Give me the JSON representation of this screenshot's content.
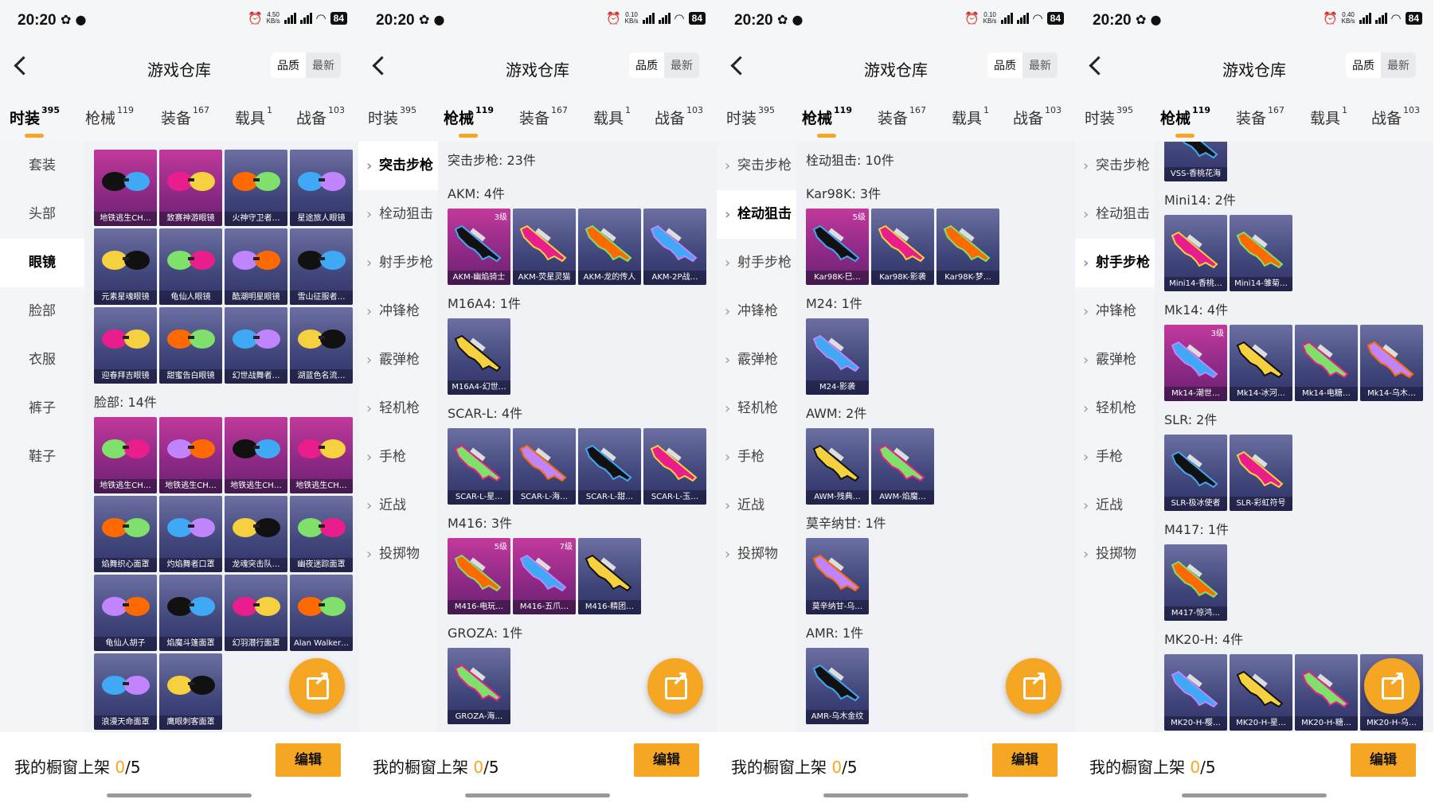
{
  "status": {
    "time": "20:20",
    "battery": "84",
    "apps": "✿ ●",
    "speeds": [
      "4.50",
      "0.10",
      "0.10",
      "0.40"
    ],
    "speed_unit": "KB/s"
  },
  "header": {
    "title": "游戏仓库",
    "sort_quality": "品质",
    "sort_latest": "最新"
  },
  "tabs": [
    {
      "label": "时装",
      "count": "395"
    },
    {
      "label": "枪械",
      "count": "119"
    },
    {
      "label": "装备",
      "count": "167"
    },
    {
      "label": "载具",
      "count": "1"
    },
    {
      "label": "战备",
      "count": "103"
    }
  ],
  "fashion_sidebar": [
    "套装",
    "头部",
    "眼镜",
    "脸部",
    "衣服",
    "裤子",
    "鞋子"
  ],
  "gun_sidebar": [
    "突击步枪",
    "栓动狙击",
    "射手步枪",
    "冲锋枪",
    "霰弹枪",
    "轻机枪",
    "手枪",
    "近战",
    "投掷物"
  ],
  "bottom": {
    "label": "我的橱窗上架 ",
    "count": "0",
    "total": "/5",
    "edit": "编辑"
  },
  "panel1": {
    "glasses": [
      {
        "name": "地铁逃生CH…",
        "purple": true
      },
      {
        "name": "致赛神游眼镜",
        "purple": true
      },
      {
        "name": "火神守卫者…",
        "purple": false
      },
      {
        "name": "星途旅人眼镜",
        "purple": false
      },
      {
        "name": "元素星魂眼镜",
        "purple": false
      },
      {
        "name": "龟仙人眼镜",
        "purple": false
      },
      {
        "name": "酷潮明星眼镜",
        "purple": false
      },
      {
        "name": "雪山征服者…",
        "purple": false
      },
      {
        "name": "迎春拜吉眼镜",
        "purple": false
      },
      {
        "name": "甜蜜告白眼镜",
        "purple": false
      },
      {
        "name": "幻世战舞者…",
        "purple": false
      },
      {
        "name": "湖蓝色名流…",
        "purple": false
      }
    ],
    "face_title": "脸部: 14件",
    "face": [
      {
        "name": "地铁逃生CH…",
        "purple": true
      },
      {
        "name": "地铁逃生CH…",
        "purple": true
      },
      {
        "name": "地铁逃生CH…",
        "purple": true
      },
      {
        "name": "地铁逃生CH…",
        "purple": true
      },
      {
        "name": "焰舞织心面罩",
        "purple": false
      },
      {
        "name": "灼焰舞者口罩",
        "purple": false
      },
      {
        "name": "龙魂突击队…",
        "purple": false
      },
      {
        "name": "幽夜迷踪面罩",
        "purple": false
      },
      {
        "name": "龟仙人胡子",
        "purple": false
      },
      {
        "name": "焰魔斗篷面罩",
        "purple": false
      },
      {
        "name": "幻羽潜行面罩",
        "purple": false
      },
      {
        "name": "Alan Walker…",
        "purple": false
      },
      {
        "name": "浪漫天命面罩",
        "purple": false
      },
      {
        "name": "鹰眼刺客面罩",
        "purple": false
      }
    ]
  },
  "panel2": {
    "sections": [
      {
        "title": "突击步枪: 23件",
        "items": []
      },
      {
        "title": "AKM: 4件",
        "items": [
          {
            "name": "AKM-幽焰骑士",
            "purple": true,
            "level": "3级"
          },
          {
            "name": "AKM-荧星灵猫",
            "purple": false,
            "level": ""
          },
          {
            "name": "AKM-龙的传人",
            "purple": false,
            "level": ""
          },
          {
            "name": "AKM-2P战…",
            "purple": false,
            "level": ""
          }
        ]
      },
      {
        "title": "M16A4: 1件",
        "items": [
          {
            "name": "M16A4-幻世…",
            "purple": false,
            "level": ""
          }
        ]
      },
      {
        "title": "SCAR-L: 4件",
        "items": [
          {
            "name": "SCAR-L-星…",
            "purple": false,
            "level": ""
          },
          {
            "name": "SCAR-L-海…",
            "purple": false,
            "level": ""
          },
          {
            "name": "SCAR-L-甜…",
            "purple": false,
            "level": ""
          },
          {
            "name": "SCAR-L-玉…",
            "purple": false,
            "level": ""
          }
        ]
      },
      {
        "title": "M416: 3件",
        "items": [
          {
            "name": "M416-电玩…",
            "purple": true,
            "level": "5级"
          },
          {
            "name": "M416-五爪…",
            "purple": true,
            "level": "7级"
          },
          {
            "name": "M416-精团…",
            "purple": false,
            "level": ""
          }
        ]
      },
      {
        "title": "GROZA: 1件",
        "items": [
          {
            "name": "GROZA-海…",
            "purple": false,
            "level": ""
          }
        ]
      }
    ]
  },
  "panel3": {
    "sections": [
      {
        "title": "栓动狙击: 10件",
        "items": []
      },
      {
        "title": "Kar98K: 3件",
        "items": [
          {
            "name": "Kar98K-巳…",
            "purple": true,
            "level": "5级"
          },
          {
            "name": "Kar98K-影袭",
            "purple": false,
            "level": ""
          },
          {
            "name": "Kar98K-梦…",
            "purple": false,
            "level": ""
          }
        ]
      },
      {
        "title": "M24: 1件",
        "items": [
          {
            "name": "M24-影袭",
            "purple": false,
            "level": ""
          }
        ]
      },
      {
        "title": "AWM: 2件",
        "items": [
          {
            "name": "AWM-残典…",
            "purple": false,
            "level": ""
          },
          {
            "name": "AWM-焰魔…",
            "purple": false,
            "level": ""
          }
        ]
      },
      {
        "title": "莫辛纳甘: 1件",
        "items": [
          {
            "name": "莫辛纳甘-乌…",
            "purple": false,
            "level": ""
          }
        ]
      },
      {
        "title": "AMR: 1件",
        "items": [
          {
            "name": "AMR-乌木金纹",
            "purple": false,
            "level": ""
          }
        ]
      }
    ]
  },
  "panel4": {
    "top_item": {
      "name": "VSS-香桃花海",
      "purple": false,
      "level": ""
    },
    "sections": [
      {
        "title": "Mini14: 2件",
        "items": [
          {
            "name": "Mini14-香桃…",
            "purple": false,
            "level": ""
          },
          {
            "name": "Mini14-雏菊…",
            "purple": false,
            "level": ""
          }
        ]
      },
      {
        "title": "Mk14: 4件",
        "items": [
          {
            "name": "Mk14-潮世…",
            "purple": true,
            "level": "3级"
          },
          {
            "name": "Mk14-冰河…",
            "purple": false,
            "level": ""
          },
          {
            "name": "Mk14-电糖…",
            "purple": false,
            "level": ""
          },
          {
            "name": "Mk14-乌木…",
            "purple": false,
            "level": ""
          }
        ]
      },
      {
        "title": "SLR: 2件",
        "items": [
          {
            "name": "SLR-极冰使者",
            "purple": false,
            "level": ""
          },
          {
            "name": "SLR-彩虹符号",
            "purple": false,
            "level": ""
          }
        ]
      },
      {
        "title": "M417: 1件",
        "items": [
          {
            "name": "M417-惊鸿…",
            "purple": false,
            "level": ""
          }
        ]
      },
      {
        "title": "MK20-H: 4件",
        "items": [
          {
            "name": "MK20-H-樱…",
            "purple": false,
            "level": ""
          },
          {
            "name": "MK20-H-星…",
            "purple": false,
            "level": ""
          },
          {
            "name": "MK20-H-糖…",
            "purple": false,
            "level": ""
          },
          {
            "name": "MK20-H-乌…",
            "purple": false,
            "level": ""
          }
        ]
      }
    ]
  }
}
